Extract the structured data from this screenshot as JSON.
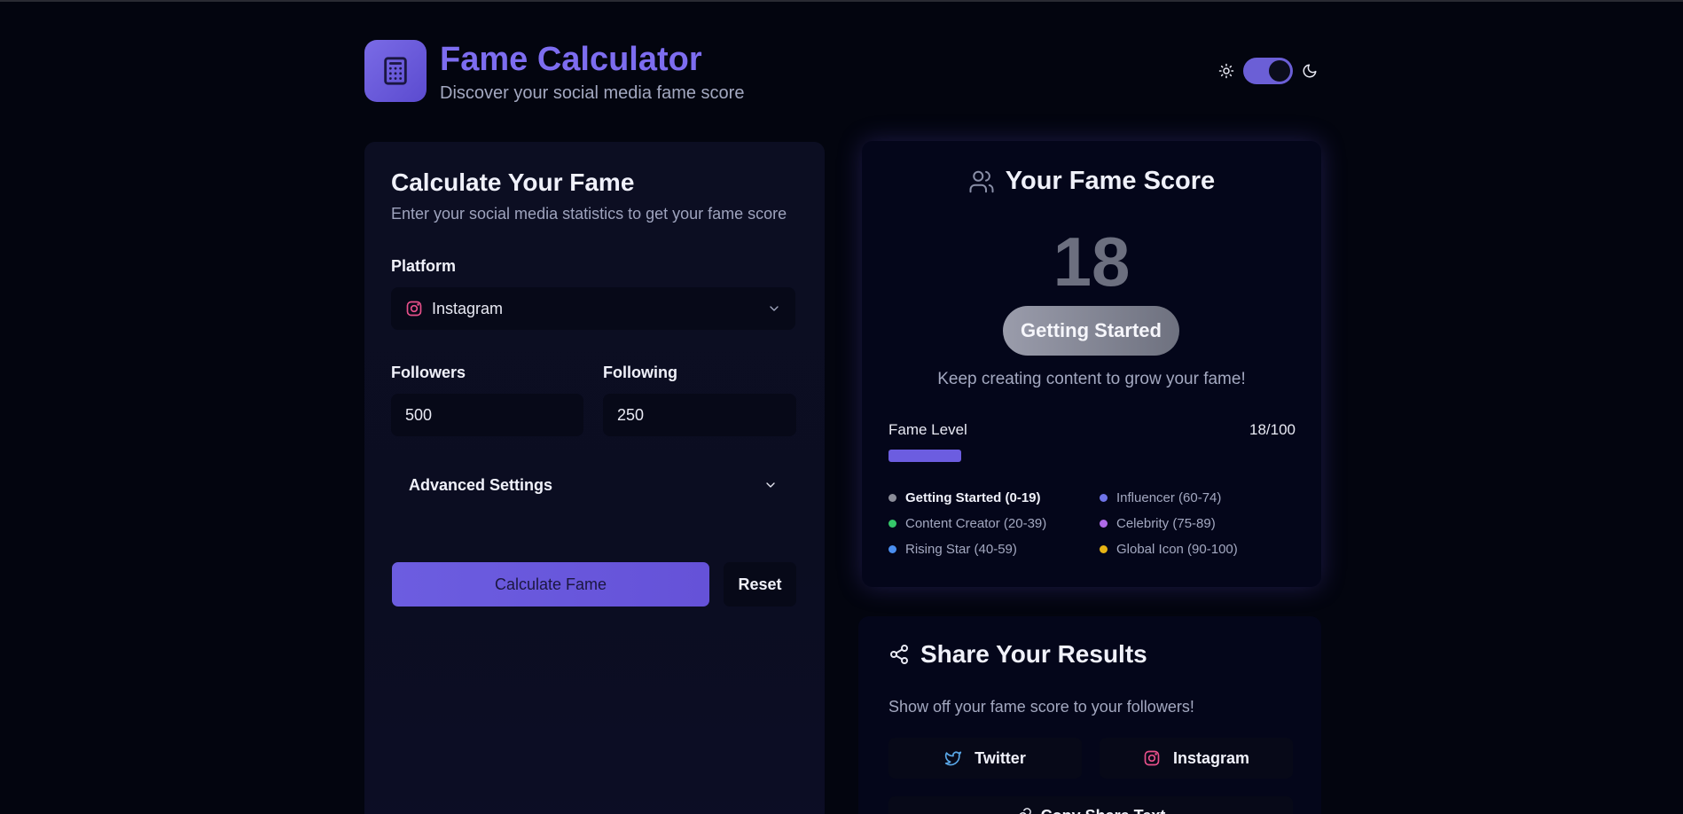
{
  "header": {
    "title": "Fame Calculator",
    "subtitle": "Discover your social media fame score"
  },
  "theme_toggle": {
    "state": "dark"
  },
  "calculator": {
    "title": "Calculate Your Fame",
    "subtitle": "Enter your social media statistics to get your fame score",
    "platform_label": "Platform",
    "platform_value": "Instagram",
    "followers_label": "Followers",
    "followers_value": "500",
    "following_label": "Following",
    "following_value": "250",
    "advanced_label": "Advanced Settings",
    "calculate_label": "Calculate Fame",
    "reset_label": "Reset"
  },
  "score": {
    "title": "Your Fame Score",
    "value": "18",
    "badge": "Getting Started",
    "message": "Keep creating content to grow your fame!",
    "level_label": "Fame Level",
    "level_value": "18/100",
    "level_fraction": 0.18,
    "legend": [
      {
        "label": "Getting Started (0-19)",
        "color": "#8b8d99",
        "active": true
      },
      {
        "label": "Influencer (60-74)",
        "color": "#6f74e8",
        "active": false
      },
      {
        "label": "Content Creator (20-39)",
        "color": "#35c76a",
        "active": false
      },
      {
        "label": "Celebrity (75-89)",
        "color": "#b06ae8",
        "active": false
      },
      {
        "label": "Rising Star (40-59)",
        "color": "#4a8ef0",
        "active": false
      },
      {
        "label": "Global Icon (90-100)",
        "color": "#e8b414",
        "active": false
      }
    ]
  },
  "share": {
    "title": "Share Your Results",
    "subtitle": "Show off your fame score to your followers!",
    "twitter_label": "Twitter",
    "instagram_label": "Instagram",
    "copy_label": "Copy Share Text"
  },
  "colors": {
    "accent": "#6c5de0",
    "background": "#03050f",
    "instagram_pink": "#e8508a",
    "twitter_blue": "#5aa8e8"
  }
}
